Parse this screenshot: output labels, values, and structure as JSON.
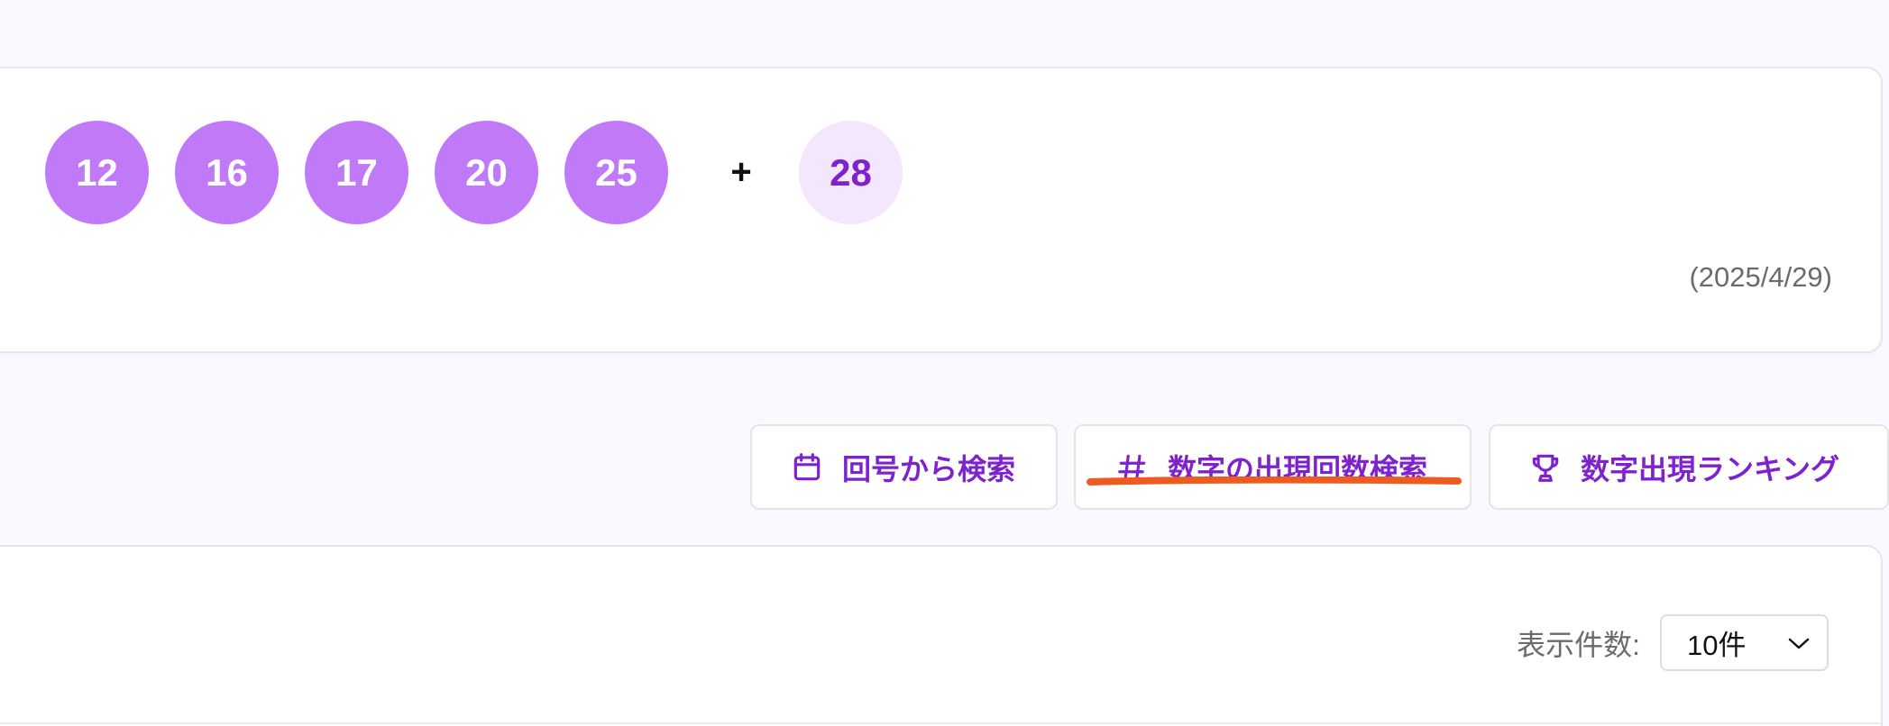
{
  "draw": {
    "main_numbers": [
      "12",
      "16",
      "17",
      "20",
      "25"
    ],
    "plus_sign": "+",
    "bonus_number": "28",
    "date": "(2025/4/29)"
  },
  "search_tabs": {
    "round_label": "回号から検索",
    "count_label": "数字の出現回数検索",
    "ranking_label": "数字出現ランキング"
  },
  "results": {
    "page_size_label": "表示件数:",
    "page_size_value": "10件"
  },
  "colors": {
    "ball": "#c07af7",
    "bonus_ball": "#f3e6fd",
    "accent": "#7e22ce",
    "highlight_underline": "#ee5b1f"
  },
  "icons": {
    "round": "calendar-icon",
    "count": "hash-icon",
    "ranking": "trophy-icon",
    "select": "chevron-down-icon"
  }
}
